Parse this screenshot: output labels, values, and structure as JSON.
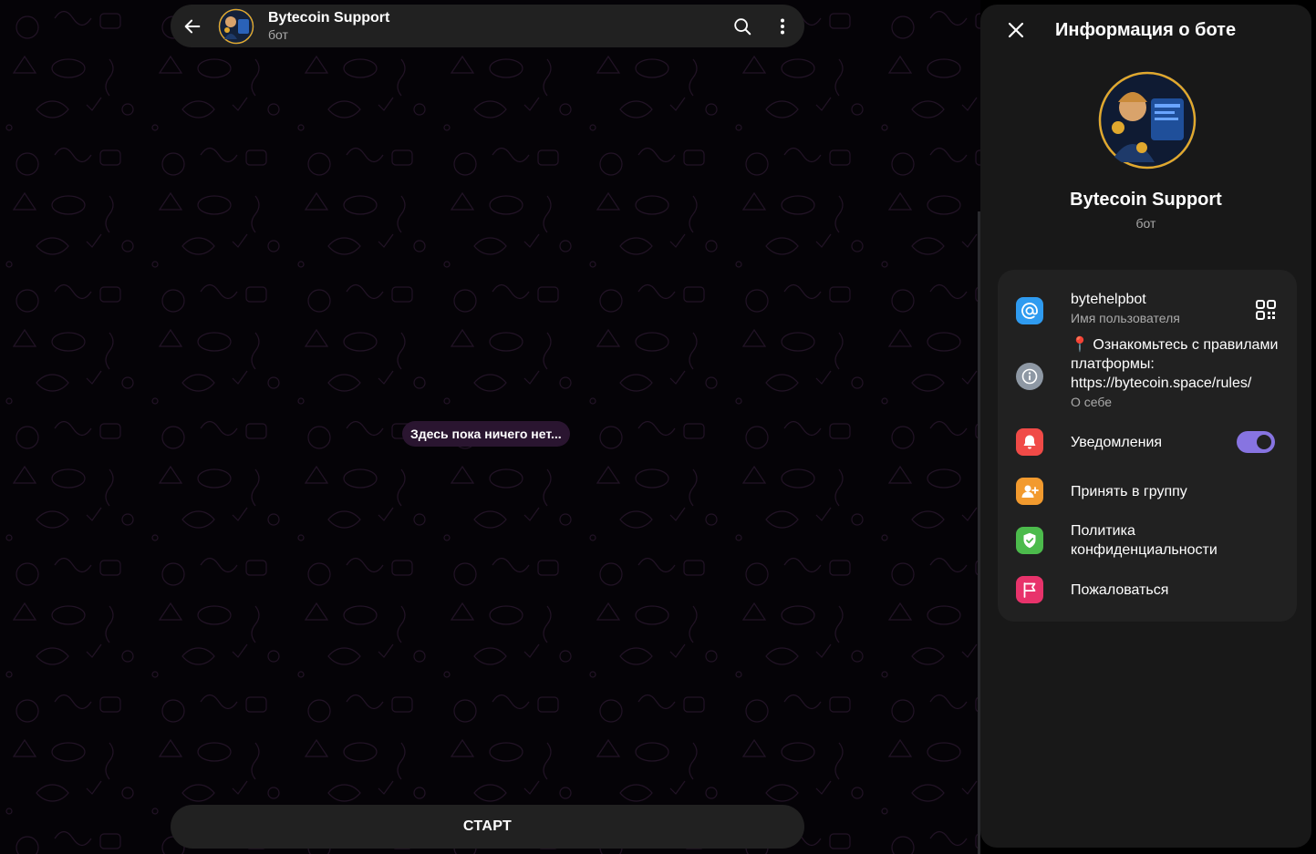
{
  "chat": {
    "header": {
      "title": "Bytecoin Support",
      "subtitle": "бот"
    },
    "empty_message": "Здесь пока ничего нет...",
    "start_label": "СТАРТ"
  },
  "panel": {
    "title": "Информация о боте",
    "profile": {
      "name": "Bytecoin Support",
      "status": "бот"
    },
    "rows": {
      "username": {
        "value": "bytehelpbot",
        "label": "Имя пользователя"
      },
      "about": {
        "value": "📍 Ознакомьтесь с правилами платформы: https://bytecoin.space/rules/",
        "label": "О себе"
      },
      "notifications": {
        "label": "Уведомления",
        "enabled": true
      },
      "add_to_group": {
        "label": "Принять в группу"
      },
      "privacy": {
        "label": "Политика конфиденциальности"
      },
      "report": {
        "label": "Пожаловаться"
      }
    }
  },
  "colors": {
    "accent": "#8774e1",
    "username_icon": "#2f9bf0",
    "about_icon": "#8e98a4",
    "notifications_icon": "#f04a47",
    "add_group_icon": "#f29a2e",
    "privacy_icon": "#4cbb4c",
    "report_icon": "#e8336b"
  }
}
